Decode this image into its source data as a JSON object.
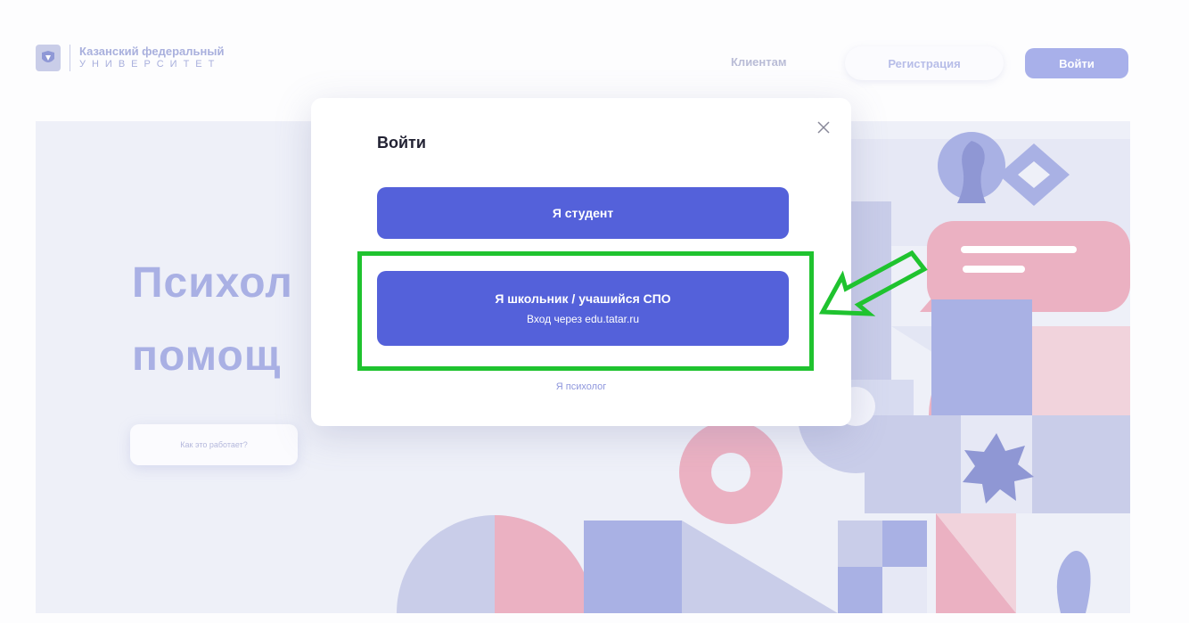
{
  "header": {
    "logo_line1": "Казанский федеральный",
    "logo_line2": "УНИВЕРСИТЕТ",
    "nav_clients": "Клиентам",
    "register_label": "Регистрация",
    "login_label": "Войти"
  },
  "hero": {
    "title_line1": "Психол",
    "title_line2": "помощ",
    "how_it_works": "Как это работает?"
  },
  "modal": {
    "title": "Войти",
    "student_button": "Я студент",
    "school_button_title": "Я школьник / учашийся СПО",
    "school_button_subtitle": "Вход через edu.tatar.ru",
    "psychologist_link": "Я психолог"
  },
  "colors": {
    "primary": "#5461da",
    "highlight": "#1fc32f",
    "hero_bg": "#eef0f8"
  },
  "icons": {
    "close": "close-icon",
    "logo": "kfu-logo-icon",
    "annotation_arrow": "arrow-icon"
  }
}
